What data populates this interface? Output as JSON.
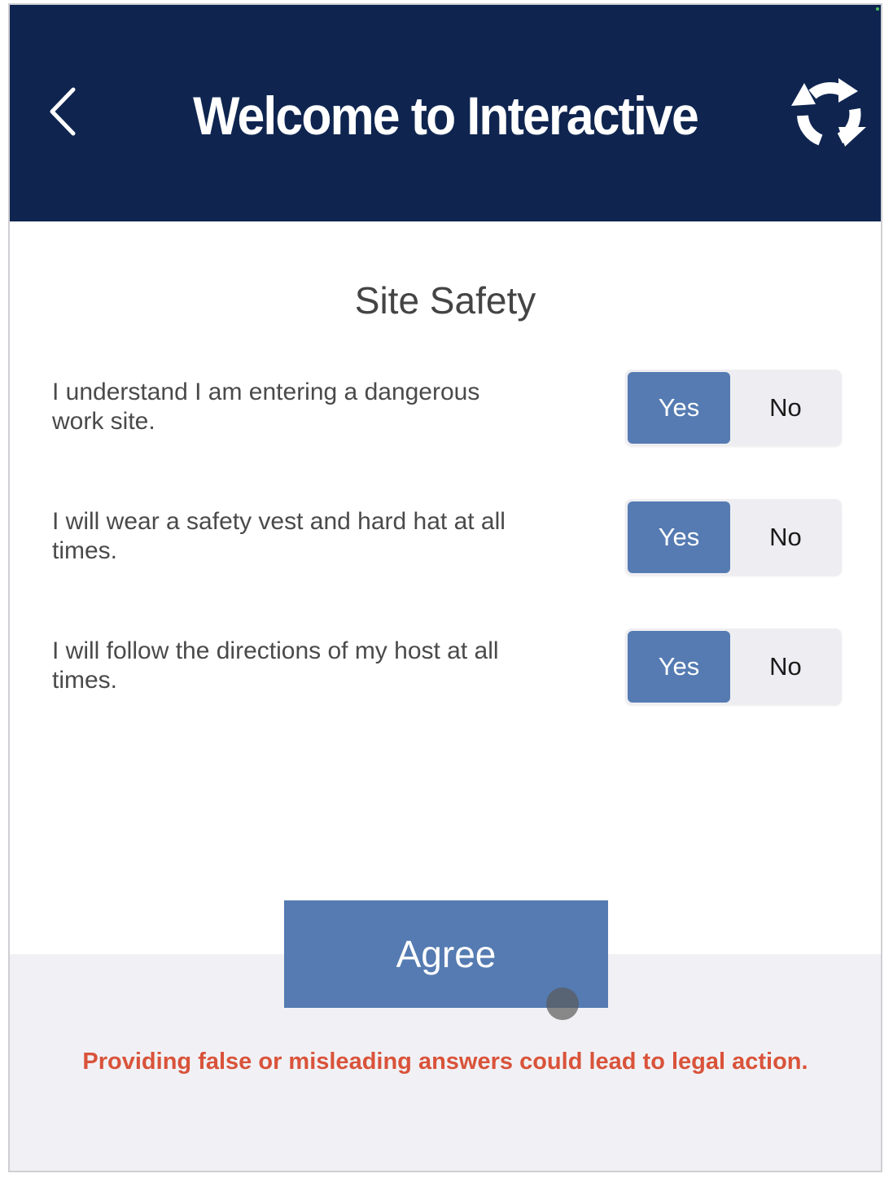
{
  "header": {
    "title": "Welcome to Interactive",
    "back_icon": "chevron-left-icon",
    "refresh_icon": "refresh-cycle-icon",
    "background_color": "#0f2550"
  },
  "section": {
    "title": "Site Safety"
  },
  "questions": [
    {
      "text": "I understand I am entering a dangerous work site.",
      "yes_label": "Yes",
      "no_label": "No",
      "selected": "Yes"
    },
    {
      "text": "I will wear a safety vest and hard hat at all times.",
      "yes_label": "Yes",
      "no_label": "No",
      "selected": "Yes"
    },
    {
      "text": "I will follow the directions of my host at all times.",
      "yes_label": "Yes",
      "no_label": "No",
      "selected": "Yes"
    }
  ],
  "agree_button": {
    "label": "Agree",
    "color": "#557bb2"
  },
  "warning": {
    "text": "Providing false or misleading answers could lead to legal action.",
    "color": "#d9533a"
  }
}
